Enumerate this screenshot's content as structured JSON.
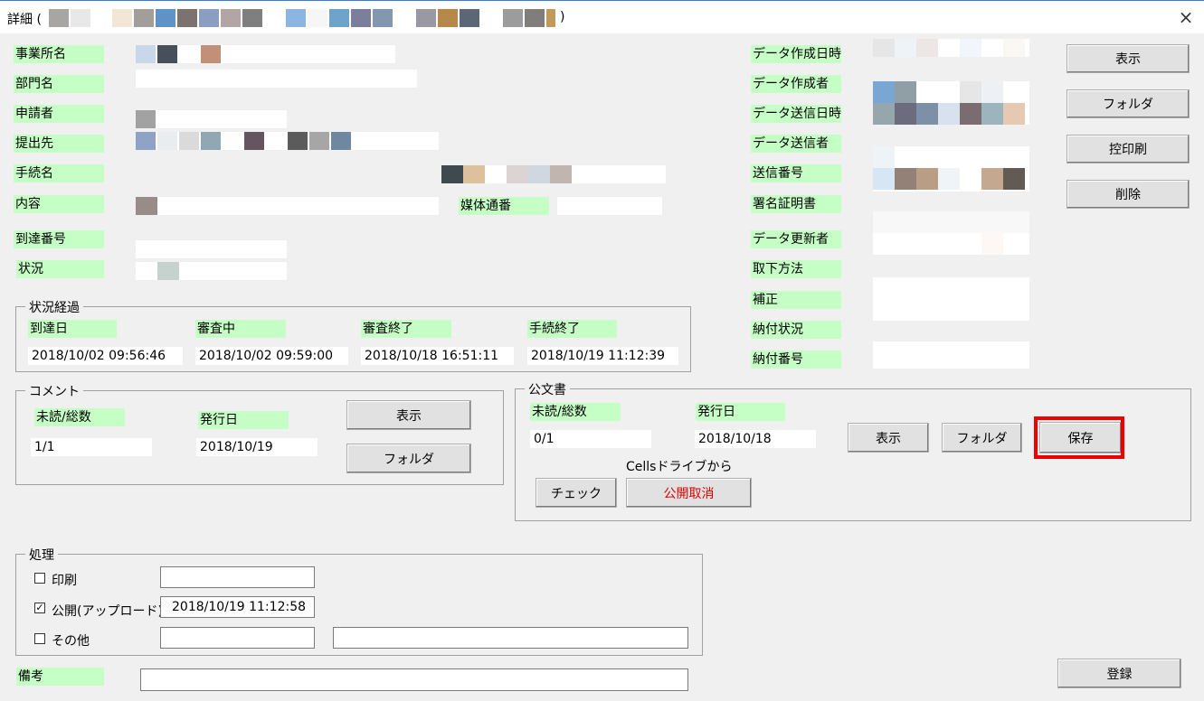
{
  "window": {
    "title": "詳細 (",
    "title_end": ")",
    "close_icon": "×"
  },
  "fields_left": [
    {
      "label": "事業所名"
    },
    {
      "label": "部門名"
    },
    {
      "label": "申請者"
    },
    {
      "label": "提出先"
    },
    {
      "label": "手続名"
    },
    {
      "label": "内容"
    },
    {
      "label": "到達番号"
    },
    {
      "label": "状況"
    }
  ],
  "media_label": "媒体通番",
  "fields_right": [
    {
      "label": "データ作成日時"
    },
    {
      "label": "データ作成者"
    },
    {
      "label": "データ送信日時"
    },
    {
      "label": "データ送信者"
    },
    {
      "label": "送信番号"
    },
    {
      "label": "署名証明書"
    },
    {
      "label": "データ更新者"
    },
    {
      "label": "取下方法"
    },
    {
      "label": "補正"
    },
    {
      "label": "納付状況"
    },
    {
      "label": "納付番号"
    }
  ],
  "right_buttons": {
    "show": "表示",
    "folder": "フォルダ",
    "print": "控印刷",
    "delete": "削除"
  },
  "progress": {
    "title": "状況経過",
    "items": [
      {
        "label": "到達日",
        "value": "2018/10/02 09:56:46"
      },
      {
        "label": "審査中",
        "value": "2018/10/02 09:59:00"
      },
      {
        "label": "審査終了",
        "value": "2018/10/18 16:51:11"
      },
      {
        "label": "手続終了",
        "value": "2018/10/19 11:12:39"
      }
    ]
  },
  "comment": {
    "title": "コメント",
    "unread_label": "未読/総数",
    "unread_value": "1/1",
    "date_label": "発行日",
    "date_value": "2018/10/19",
    "show": "表示",
    "folder": "フォルダ"
  },
  "official": {
    "title": "公文書",
    "unread_label": "未読/総数",
    "unread_value": "0/1",
    "date_label": "発行日",
    "date_value": "2018/10/18",
    "show": "表示",
    "folder": "フォルダ",
    "save": "保存",
    "cells_label": "Cellsドライブから",
    "check": "チェック",
    "cancel_publish": "公開取消"
  },
  "process": {
    "title": "処理",
    "print_label": "印刷",
    "print_checked": false,
    "publish_label": "公開(アップロード)",
    "publish_checked": true,
    "publish_value": "2018/10/19 11:12:58",
    "other_label": "その他",
    "other_checked": false
  },
  "remarks_label": "備考",
  "register": "登録",
  "colors": {
    "label_bg": "#c6ffc6",
    "highlight": "#ee0000"
  }
}
